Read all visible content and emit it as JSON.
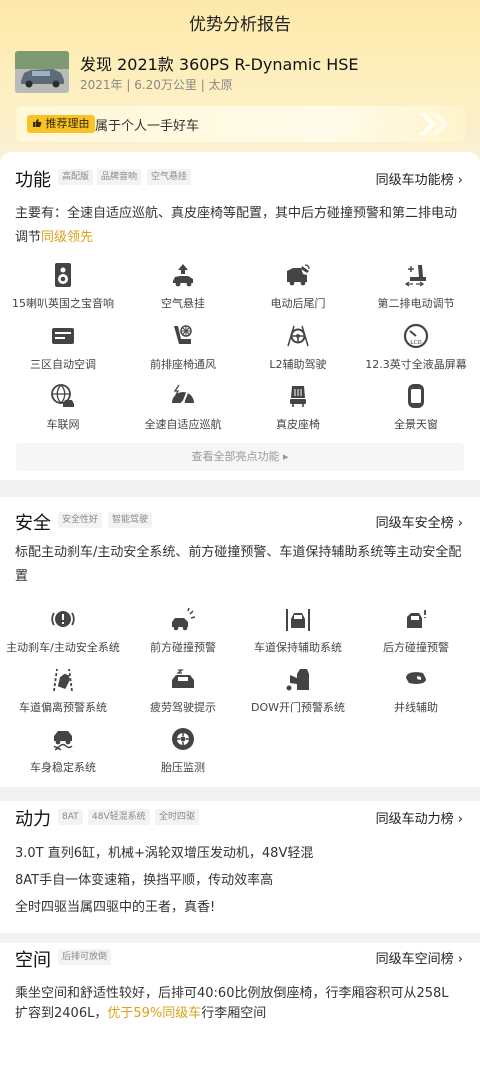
{
  "header": {
    "title": "优势分析报告"
  },
  "car": {
    "name": "发现 2021款 360PS R-Dynamic HSE",
    "meta": "2021年 | 6.20万公里 | 太原"
  },
  "recommend": {
    "tag": "推荐理由",
    "text": "属于个人一手好车"
  },
  "features": {
    "title": "功能",
    "chips": [
      "高配版",
      "品牌音响",
      "空气悬挂"
    ],
    "rank_link": "同级车功能榜 ›",
    "desc": "主要有：全速自适应巡航、真皮座椅等配置，其中后方碰撞预警和第二排电动调节",
    "desc_highlight": "同级领先",
    "items": [
      {
        "label": "15喇叭英国之宝音响",
        "icon": "speaker-icon"
      },
      {
        "label": "空气悬挂",
        "icon": "air-suspension-icon"
      },
      {
        "label": "电动后尾门",
        "icon": "power-tailgate-icon"
      },
      {
        "label": "第二排电动调节",
        "icon": "power-seat-icon"
      },
      {
        "label": "三区自动空调",
        "icon": "air-conditioner-icon"
      },
      {
        "label": "前排座椅通风",
        "icon": "seat-ventilation-icon"
      },
      {
        "label": "L2辅助驾驶",
        "icon": "assisted-driving-icon"
      },
      {
        "label": "12.3英寸全液晶屏幕",
        "icon": "lcd-icon"
      },
      {
        "label": "车联网",
        "icon": "globe-car-icon"
      },
      {
        "label": "全速自适应巡航",
        "icon": "cruise-gauge-icon"
      },
      {
        "label": "真皮座椅",
        "icon": "leather-seat-icon"
      },
      {
        "label": "全景天窗",
        "icon": "panoramic-sunroof-icon"
      }
    ],
    "view_all": "查看全部亮点功能 ▸"
  },
  "safety": {
    "title": "安全",
    "chips": [
      "安全性好",
      "智能驾驶"
    ],
    "rank_link": "同级车安全榜 ›",
    "desc": "标配主动刹车/主动安全系统、前方碰撞预警、车道保持辅助系统等主动安全配置",
    "items": [
      {
        "label": "主动刹车/主动安全系统",
        "icon": "brake-warning-icon"
      },
      {
        "label": "前方碰撞预警",
        "icon": "front-collision-icon"
      },
      {
        "label": "车道保持辅助系统",
        "icon": "lane-keep-icon"
      },
      {
        "label": "后方碰撞预警",
        "icon": "rear-collision-icon"
      },
      {
        "label": "车道偏离预警系统",
        "icon": "lane-departure-icon"
      },
      {
        "label": "疲劳驾驶提示",
        "icon": "fatigue-icon"
      },
      {
        "label": "DOW开门预警系统",
        "icon": "door-open-warning-icon"
      },
      {
        "label": "并线辅助",
        "icon": "blind-spot-icon"
      },
      {
        "label": "车身稳定系统",
        "icon": "stability-icon"
      },
      {
        "label": "胎压监测",
        "icon": "tire-pressure-icon"
      }
    ]
  },
  "power": {
    "title": "动力",
    "chips": [
      "8AT",
      "48V轻混系统",
      "全时四驱"
    ],
    "rank_link": "同级车动力榜 ›",
    "lines": [
      "3.0T 直列6缸，机械+涡轮双增压发动机，48V轻混",
      "8AT手自一体变速箱，换挡平顺，传动效率高",
      "全时四驱当属四驱中的王者，真香!"
    ]
  },
  "space": {
    "title": "空间",
    "chips": [
      "后排可放倒"
    ],
    "rank_link": "同级车空间榜 ›",
    "desc_line1": "乘坐空间和舒适性较好，后排可40:60比例放倒座椅，行李厢容积可从258L",
    "desc_line2_pre": "扩容到2406L，",
    "desc_line2_hl": "优于59%同级车",
    "desc_line2_post": "行李厢空间"
  },
  "colors": {
    "accent": "#f8c327",
    "highlight": "#dba11c",
    "header_bg": "#fde9a8"
  }
}
